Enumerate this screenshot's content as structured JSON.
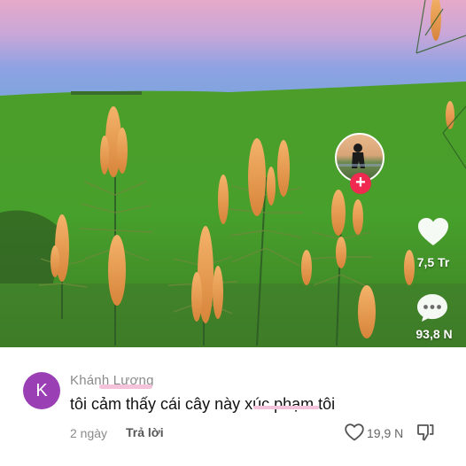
{
  "video": {
    "likes": "7,5 Tr",
    "comments": "93,8 N"
  },
  "comment": {
    "avatar_letter": "K",
    "username": "Khánh Lương",
    "text": "tôi cảm thấy cái cây này xúc phạm tôi",
    "time": "2 ngày",
    "reply_label": "Trả lời",
    "like_count": "19,9 N"
  },
  "colors": {
    "follow_button": "#ef2950",
    "avatar_bg": "#9b3fb5",
    "grass": "#4fa32a"
  },
  "icons": [
    "heart-icon",
    "comment-bubble-icon",
    "plus-icon",
    "thumbs-down-icon"
  ]
}
